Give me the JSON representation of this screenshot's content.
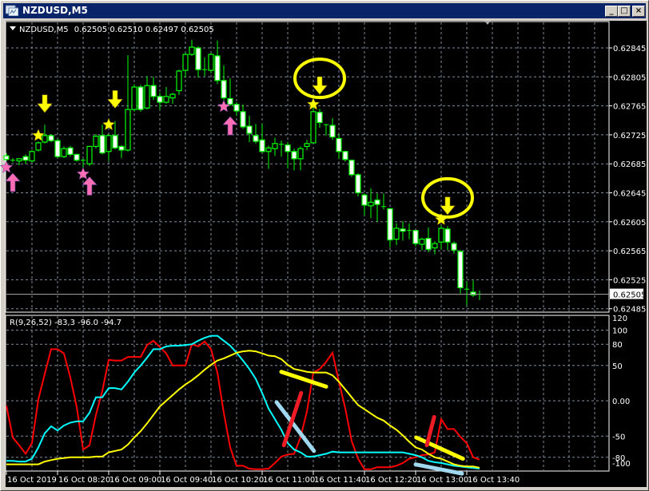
{
  "window": {
    "title": "NZDUSD,M5",
    "buttons": {
      "minimize": "_",
      "restore": "□",
      "close": "×"
    }
  },
  "colors": {
    "background": "#000000",
    "grid": "#7f8c9c",
    "candle_outline": "#00ff00",
    "bull_fill": "#000000",
    "bear_fill": "#ffffff",
    "sell_signal": "#ffff00",
    "buy_signal": "#ff6eb4",
    "line_fast": "#ff0000",
    "line_mid": "#00ffff",
    "line_slow": "#ffff00",
    "current_price_line": "#a0a0a0"
  },
  "chart_data": [
    {
      "type": "candlestick",
      "title": "NZDUSD,M5",
      "header": {
        "symbol": "NZDUSD,M5",
        "open": "0.62505",
        "high": "0.62510",
        "low": "0.62497",
        "close": "0.62505"
      },
      "ylim": [
        0.62474,
        0.62876
      ],
      "y_ticks": [
        "0.62845",
        "0.62805",
        "0.62765",
        "0.62725",
        "0.62685",
        "0.62645",
        "0.62605",
        "0.62565",
        "0.62525",
        "0.62485"
      ],
      "current_price": "0.62505",
      "x_ticks": [
        {
          "candle": 1,
          "label": "16 Oct 2019"
        },
        {
          "candle": 9,
          "label": "16 Oct 08:20"
        },
        {
          "candle": 17,
          "label": "16 Oct 09:00"
        },
        {
          "candle": 25,
          "label": "16 Oct 09:40"
        },
        {
          "candle": 33,
          "label": "16 Oct 10:20"
        },
        {
          "candle": 41,
          "label": "16 Oct 11:00"
        },
        {
          "candle": 49,
          "label": "16 Oct 11:40"
        },
        {
          "candle": 57,
          "label": "16 Oct 12:20"
        },
        {
          "candle": 65,
          "label": "16 Oct 13:00"
        },
        {
          "candle": 73,
          "label": "16 Oct 13:40"
        }
      ],
      "grid": true,
      "candles_ohlc": [
        [
          0.62696,
          0.627,
          0.62688,
          0.62691
        ],
        [
          0.6269,
          0.62693,
          0.62687,
          0.62689
        ],
        [
          0.62689,
          0.62693,
          0.62683,
          0.62692
        ],
        [
          0.62695,
          0.62698,
          0.62685,
          0.6269
        ],
        [
          0.62689,
          0.62704,
          0.62687,
          0.62702
        ],
        [
          0.62704,
          0.62716,
          0.62702,
          0.62714
        ],
        [
          0.62715,
          0.62739,
          0.62713,
          0.62724
        ],
        [
          0.62724,
          0.62726,
          0.62715,
          0.62717
        ],
        [
          0.62717,
          0.6272,
          0.62693,
          0.62695
        ],
        [
          0.62695,
          0.62709,
          0.62693,
          0.62706
        ],
        [
          0.62707,
          0.6271,
          0.62695,
          0.62698
        ],
        [
          0.62698,
          0.62699,
          0.62688,
          0.6269
        ],
        [
          0.6269,
          0.62692,
          0.6268,
          0.6269
        ],
        [
          0.62685,
          0.6271,
          0.62682,
          0.62709
        ],
        [
          0.62709,
          0.62726,
          0.62706,
          0.62723
        ],
        [
          0.62724,
          0.62739,
          0.62698,
          0.627
        ],
        [
          0.62702,
          0.62726,
          0.62689,
          0.62724
        ],
        [
          0.62724,
          0.62744,
          0.62705,
          0.62707
        ],
        [
          0.62709,
          0.62711,
          0.62693,
          0.62704
        ],
        [
          0.62704,
          0.62835,
          0.62702,
          0.6276
        ],
        [
          0.6276,
          0.62795,
          0.62757,
          0.62791
        ],
        [
          0.62791,
          0.62794,
          0.62757,
          0.6276
        ],
        [
          0.62762,
          0.62806,
          0.6276,
          0.62793
        ],
        [
          0.62793,
          0.62805,
          0.62773,
          0.62778
        ],
        [
          0.62778,
          0.62783,
          0.6276,
          0.6277
        ],
        [
          0.6277,
          0.62791,
          0.62768,
          0.62778
        ],
        [
          0.62776,
          0.62783,
          0.62768,
          0.62781
        ],
        [
          0.62786,
          0.62815,
          0.6278,
          0.62813
        ],
        [
          0.62814,
          0.62838,
          0.62804,
          0.62836
        ],
        [
          0.62836,
          0.62856,
          0.62834,
          0.62846
        ],
        [
          0.62845,
          0.62847,
          0.62804,
          0.62815
        ],
        [
          0.62815,
          0.62832,
          0.62806,
          0.62815
        ],
        [
          0.62814,
          0.62838,
          0.6281,
          0.62836
        ],
        [
          0.62834,
          0.62855,
          0.62795,
          0.628
        ],
        [
          0.628,
          0.62821,
          0.62773,
          0.62776
        ],
        [
          0.62775,
          0.62803,
          0.62765,
          0.62767
        ],
        [
          0.62767,
          0.6277,
          0.62751,
          0.62758
        ],
        [
          0.62757,
          0.62767,
          0.62733,
          0.62736
        ],
        [
          0.62737,
          0.62751,
          0.62715,
          0.62727
        ],
        [
          0.62724,
          0.6274,
          0.62713,
          0.62716
        ],
        [
          0.62718,
          0.6274,
          0.627,
          0.62702
        ],
        [
          0.62702,
          0.6271,
          0.62678,
          0.62707
        ],
        [
          0.62706,
          0.62721,
          0.62696,
          0.62713
        ],
        [
          0.62712,
          0.62717,
          0.62695,
          0.62712
        ],
        [
          0.62711,
          0.62715,
          0.62679,
          0.62702
        ],
        [
          0.62702,
          0.62706,
          0.62676,
          0.62692
        ],
        [
          0.62692,
          0.62709,
          0.62676,
          0.62706
        ],
        [
          0.62709,
          0.62718,
          0.62704,
          0.62713
        ],
        [
          0.62714,
          0.62767,
          0.62713,
          0.62757
        ],
        [
          0.62756,
          0.62761,
          0.62735,
          0.62742
        ],
        [
          0.62739,
          0.6274,
          0.62724,
          0.62739
        ],
        [
          0.62738,
          0.62748,
          0.62718,
          0.62722
        ],
        [
          0.6272,
          0.62726,
          0.62692,
          0.62702
        ],
        [
          0.62702,
          0.62703,
          0.62688,
          0.62691
        ],
        [
          0.6269,
          0.62691,
          0.62667,
          0.6267
        ],
        [
          0.6267,
          0.62672,
          0.6264,
          0.62645
        ],
        [
          0.62642,
          0.62644,
          0.62614,
          0.62628
        ],
        [
          0.62627,
          0.62651,
          0.6261,
          0.62632
        ],
        [
          0.62635,
          0.62644,
          0.62605,
          0.62629
        ],
        [
          0.62626,
          0.62644,
          0.62622,
          0.62626
        ],
        [
          0.62623,
          0.62624,
          0.6257,
          0.6258
        ],
        [
          0.62581,
          0.62603,
          0.62573,
          0.62596
        ],
        [
          0.62595,
          0.62606,
          0.62579,
          0.62592
        ],
        [
          0.62593,
          0.62603,
          0.62581,
          0.62592
        ],
        [
          0.62593,
          0.62594,
          0.62571,
          0.62575
        ],
        [
          0.62574,
          0.62583,
          0.62566,
          0.62581
        ],
        [
          0.62582,
          0.62597,
          0.62563,
          0.62567
        ],
        [
          0.62569,
          0.62578,
          0.6256,
          0.62575
        ],
        [
          0.62577,
          0.626,
          0.62567,
          0.62596
        ],
        [
          0.62595,
          0.62599,
          0.62566,
          0.62577
        ],
        [
          0.62575,
          0.62578,
          0.62561,
          0.62566
        ],
        [
          0.62564,
          0.62566,
          0.62506,
          0.62514
        ],
        [
          0.62512,
          0.62523,
          0.6249,
          0.62511
        ],
        [
          0.62508,
          0.62524,
          0.62501,
          0.62504
        ],
        [
          0.62505,
          0.6251,
          0.62497,
          0.62505
        ]
      ],
      "signals": [
        {
          "type": "sell-star",
          "candle": 6,
          "price": 0.62724
        },
        {
          "type": "sell-arrow",
          "candle": 7,
          "price": 0.62768
        },
        {
          "type": "sell-star",
          "candle": 17,
          "price": 0.62739
        },
        {
          "type": "sell-arrow",
          "candle": 18,
          "price": 0.62774
        },
        {
          "type": "sell-star",
          "candle": 49,
          "price": 0.62767
        },
        {
          "type": "sell-arrow",
          "candle": 50,
          "price": 0.62793
        },
        {
          "type": "sell-star",
          "candle": 69,
          "price": 0.62608
        },
        {
          "type": "sell-arrow",
          "candle": 70,
          "price": 0.62627
        },
        {
          "type": "buy-star",
          "candle": 1,
          "price": 0.6268
        },
        {
          "type": "buy-arrow",
          "candle": 2,
          "price": 0.6266
        },
        {
          "type": "buy-star",
          "candle": 13,
          "price": 0.62671
        },
        {
          "type": "buy-arrow",
          "candle": 14,
          "price": 0.62655
        },
        {
          "type": "buy-star",
          "candle": 35,
          "price": 0.62764
        },
        {
          "type": "buy-arrow",
          "candle": 36,
          "price": 0.62738
        }
      ],
      "highlight_circles": [
        {
          "candle": 50,
          "price": 0.62803
        },
        {
          "candle": 70,
          "price": 0.62638
        }
      ]
    },
    {
      "type": "line",
      "title": "R(9,26,52) -83,3 -96.0 -94.7",
      "ylim": [
        -110,
        120
      ],
      "y_ticks": [
        "120",
        "100",
        "80",
        "50",
        "0.00",
        "-50",
        "-80",
        "-100"
      ],
      "grid_levels": [
        100,
        80,
        50,
        0,
        -50,
        -80
      ],
      "series": [
        {
          "name": "R9",
          "color": "#ff0000",
          "values": [
            -7,
            -52,
            -63,
            -75,
            -60,
            2,
            38,
            73,
            73,
            67,
            33,
            -9,
            -69,
            -63,
            -20,
            14,
            58,
            57,
            57,
            62,
            62,
            62,
            79,
            85,
            76,
            67,
            50,
            50,
            50,
            80,
            77,
            84,
            73,
            40,
            -17,
            -66,
            -92,
            -92,
            -96,
            -97,
            -97,
            -96,
            -88,
            -79,
            -76,
            -75,
            -52,
            -15,
            40,
            45,
            55,
            68,
            27,
            -11,
            -57,
            -82,
            -97,
            -97,
            -94,
            -94,
            -94,
            -92,
            -88,
            -82,
            -80,
            -77,
            -76,
            -73,
            -26,
            -40,
            -40,
            -51,
            -60,
            -80,
            -83.3
          ]
        },
        {
          "name": "R26",
          "color": "#00ffff",
          "values": [
            -85,
            -85,
            -86,
            -86,
            -82,
            -66,
            -46,
            -36,
            -42,
            -35,
            -31,
            -29,
            -29,
            -17,
            5,
            5,
            18,
            18,
            16,
            27,
            40,
            50,
            61,
            73,
            73,
            77,
            78,
            78,
            79,
            80,
            85,
            89,
            92,
            92,
            85,
            78,
            68,
            57,
            45,
            31,
            11,
            -11,
            -26,
            -41,
            -60,
            -69,
            -73,
            -79,
            -79,
            -77,
            -75,
            -72,
            -73,
            -73,
            -73,
            -73,
            -73,
            -73,
            -73,
            -73,
            -73,
            -73,
            -73,
            -75,
            -77,
            -80,
            -85,
            -87,
            -88,
            -90,
            -92,
            -93,
            -94,
            -95,
            -96
          ]
        },
        {
          "name": "R52",
          "color": "#ffff00",
          "values": [
            -90,
            -90,
            -90,
            -90,
            -90,
            -90,
            -86,
            -84,
            -82,
            -81,
            -80,
            -80,
            -80,
            -80,
            -79,
            -79,
            -73,
            -71,
            -69,
            -62,
            -52,
            -43,
            -32,
            -20,
            -8,
            0,
            8,
            16,
            23,
            29,
            36,
            44,
            51,
            57,
            60,
            64,
            68,
            70,
            71,
            70,
            67,
            64,
            63,
            59,
            51,
            45,
            43,
            41,
            40,
            40,
            40,
            36,
            27,
            16,
            5,
            -6,
            -12,
            -18,
            -24,
            -28,
            -35,
            -41,
            -49,
            -58,
            -66,
            -69,
            -75,
            -80,
            -82,
            -86,
            -90,
            -92,
            -93,
            -93,
            -94.7
          ]
        }
      ],
      "trendlines": [
        {
          "color": "#ffff00",
          "from": {
            "candle": 44,
            "value": 41
          },
          "to": {
            "candle": 51,
            "value": 20
          }
        },
        {
          "color": "#a0d8ef",
          "from": {
            "candle": 43.25,
            "value": -2
          },
          "to": {
            "candle": 49.1,
            "value": -71
          }
        },
        {
          "color": "#ee1c25",
          "from": {
            "candle": 47.1,
            "value": 11
          },
          "to": {
            "candle": 44.4,
            "value": -63
          }
        },
        {
          "color": "#ffff00",
          "from": {
            "candle": 65.1,
            "value": -52
          },
          "to": {
            "candle": 72.4,
            "value": -82
          }
        },
        {
          "color": "#ee1c25",
          "from": {
            "candle": 67.9,
            "value": -23
          },
          "to": {
            "candle": 66.75,
            "value": -63
          }
        },
        {
          "color": "#a0d8ef",
          "from": {
            "candle": 65,
            "value": -90
          },
          "to": {
            "candle": 72.25,
            "value": -103
          }
        }
      ]
    }
  ]
}
